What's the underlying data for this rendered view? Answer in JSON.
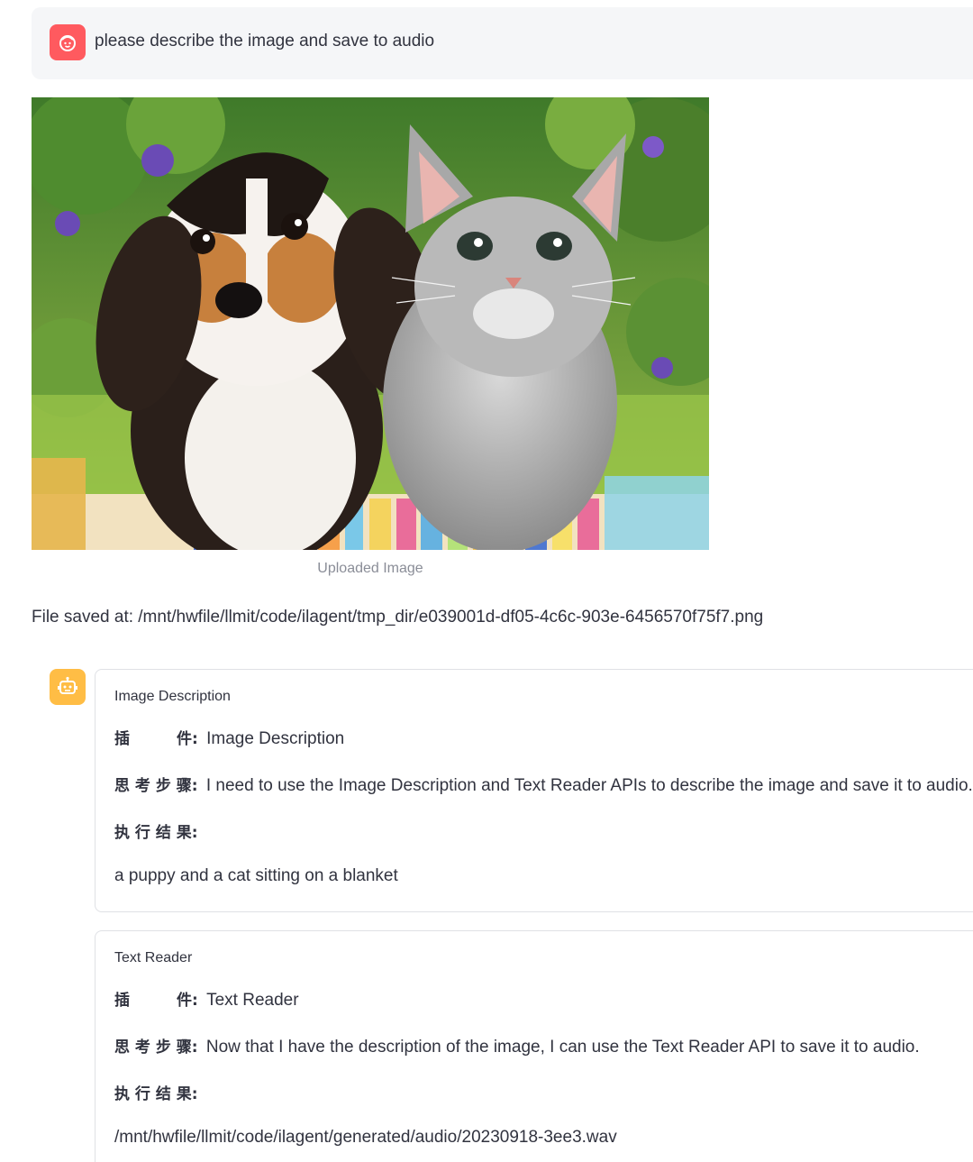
{
  "user_message": {
    "text": "please describe the image and save to audio",
    "avatar_icon": "user-face-icon",
    "avatar_color": "#ff5a5f"
  },
  "uploaded_image": {
    "caption": "Uploaded Image"
  },
  "file_saved_text": "File saved at: /mnt/hwfile/llmit/code/ilagent/tmp_dir/e039001d-df05-4c6c-903e-6456570f75f7.png",
  "bot": {
    "avatar_icon": "robot-icon",
    "avatar_color": "#ffbd45"
  },
  "labels": {
    "plugin_char1": "插",
    "plugin_char2": "件",
    "plugin_colon": ":",
    "thinking": "思 考 步 骤",
    "thinking_colon": ":",
    "result": "执 行 结 果",
    "result_colon": ":"
  },
  "tool_calls": [
    {
      "title": "Image Description",
      "plugin": "Image Description",
      "thought": "I need to use the Image Description and Text Reader APIs to describe the image and save it to audio.",
      "result": "a puppy and a cat sitting on a blanket"
    },
    {
      "title": "Text Reader",
      "plugin": "Text Reader",
      "thought": "Now that I have the description of the image, I can use the Text Reader API to save it to audio.",
      "result": "/mnt/hwfile/llmit/code/ilagent/generated/audio/20230918-3ee3.wav"
    }
  ]
}
